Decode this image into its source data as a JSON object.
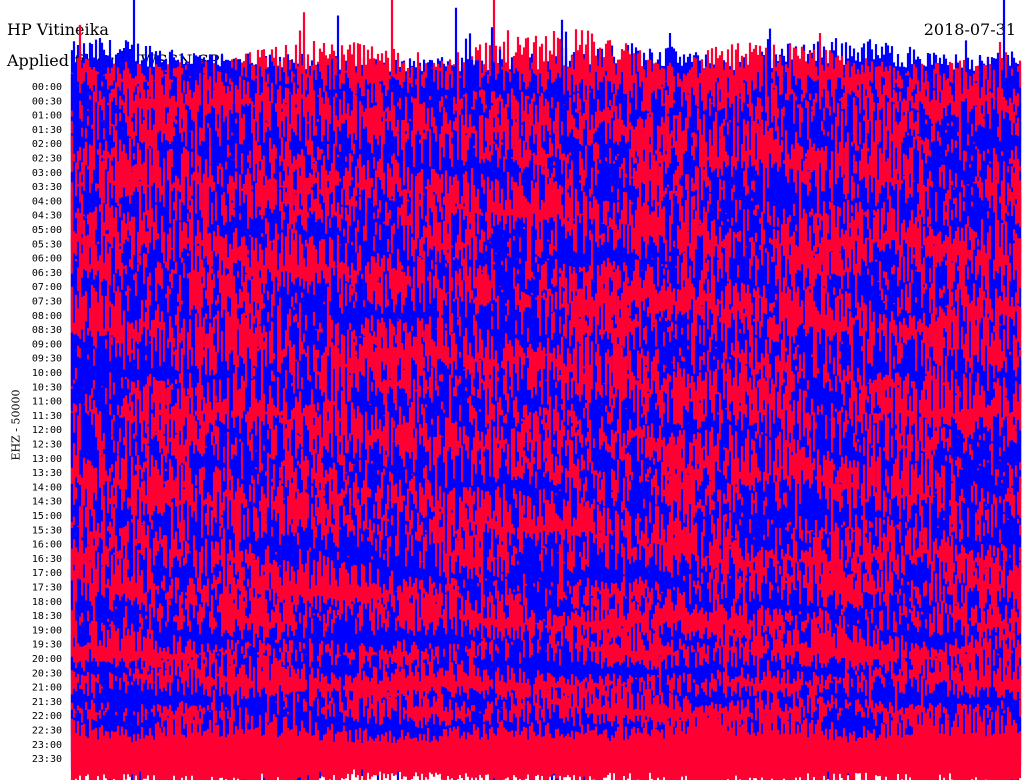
{
  "header": {
    "station": "HP Vitineika",
    "filter": "Applied filter: WWSSN-SP",
    "date": "2018-07-31"
  },
  "colors": {
    "trace_a": "#0000ff",
    "trace_b": "#ff0033",
    "background": "#ffffff"
  },
  "chart_data": {
    "type": "line",
    "title": "HP Vitineika",
    "ylabel": "EHZ - 50000",
    "x_label": "",
    "y_tick_labels": [
      "00:00",
      "00:30",
      "01:00",
      "01:30",
      "02:00",
      "02:30",
      "03:00",
      "03:30",
      "04:00",
      "04:30",
      "05:00",
      "05:30",
      "06:00",
      "06:30",
      "07:00",
      "07:30",
      "08:00",
      "08:30",
      "09:00",
      "09:30",
      "10:00",
      "10:30",
      "11:00",
      "11:30",
      "12:00",
      "12:30",
      "13:00",
      "13:30",
      "14:00",
      "14:30",
      "15:00",
      "15:30",
      "16:00",
      "16:30",
      "17:00",
      "17:30",
      "18:00",
      "18:30",
      "19:00",
      "19:30",
      "20:00",
      "20:30",
      "21:00",
      "21:30",
      "22:00",
      "22:30",
      "23:00",
      "23:30"
    ],
    "series": [
      {
        "color": "#0000ff",
        "rows": "even"
      },
      {
        "color": "#ff0033",
        "rows": "odd"
      }
    ],
    "row_amplitude_level": [
      0.55,
      0.9,
      0.75,
      0.8,
      0.9,
      1,
      1,
      1,
      1,
      1,
      1,
      1,
      1,
      1,
      1,
      1,
      1,
      1,
      1,
      1,
      1,
      1,
      1,
      1,
      1,
      1,
      1,
      1,
      1,
      1,
      1,
      1,
      1,
      1,
      1,
      1,
      1,
      0.85,
      0.8,
      0.8,
      0.7,
      0.65,
      0.6,
      0.55,
      0.5,
      0.55,
      0.6,
      0.65
    ],
    "grid": false,
    "legend": "none"
  }
}
